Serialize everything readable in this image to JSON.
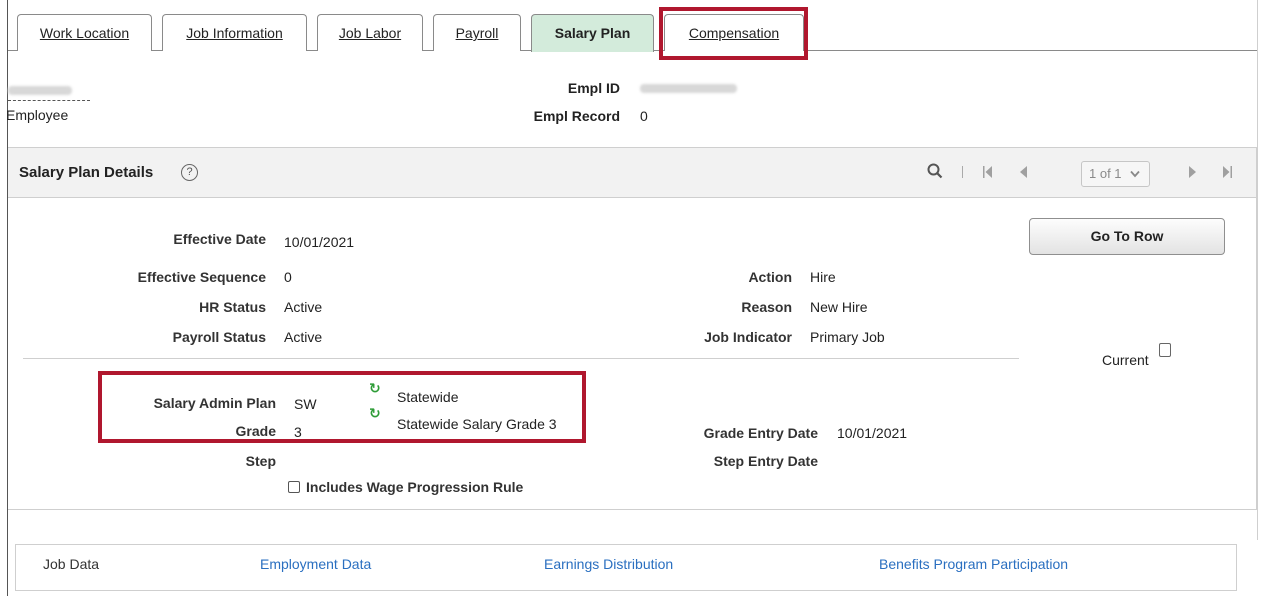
{
  "tabs": [
    {
      "label": "Work Location"
    },
    {
      "label": "Job Information"
    },
    {
      "label": "Job Labor"
    },
    {
      "label": "Payroll"
    },
    {
      "label": "Salary Plan"
    },
    {
      "label": "Compensation"
    }
  ],
  "header": {
    "employee_label": "Employee",
    "empl_id_label": "Empl ID",
    "empl_record_label": "Empl Record",
    "empl_record_value": "0"
  },
  "panel": {
    "title": "Salary Plan Details",
    "help_glyph": "?",
    "pager_text": "1 of 1"
  },
  "fields": {
    "effective_date_label": "Effective Date",
    "effective_date": "10/01/2021",
    "effective_sequence_label": "Effective Sequence",
    "effective_sequence": "0",
    "hr_status_label": "HR Status",
    "hr_status": "Active",
    "payroll_status_label": "Payroll Status",
    "payroll_status": "Active",
    "action_label": "Action",
    "action": "Hire",
    "reason_label": "Reason",
    "reason": "New Hire",
    "job_indicator_label": "Job Indicator",
    "job_indicator": "Primary Job",
    "current_label": "Current",
    "salary_admin_plan_label": "Salary Admin Plan",
    "salary_admin_plan": "SW",
    "salary_admin_plan_desc": "Statewide",
    "grade_label": "Grade",
    "grade": "3",
    "grade_desc": "Statewide Salary Grade 3",
    "grade_entry_date_label": "Grade Entry Date",
    "grade_entry_date": "10/01/2021",
    "step_label": "Step",
    "step_entry_date_label": "Step Entry Date",
    "wage_progression_label": "Includes Wage Progression Rule"
  },
  "buttons": {
    "go_to_row": "Go To Row"
  },
  "footer": {
    "job_data": "Job Data",
    "employment_data": "Employment Data",
    "earnings_distribution": "Earnings Distribution",
    "benefits_program": "Benefits Program Participation"
  },
  "colors": {
    "highlight": "#b0172e",
    "active_tab": "#d3ebdb",
    "link": "#2a6fc0",
    "refresh_icon": "#2e9c37"
  }
}
